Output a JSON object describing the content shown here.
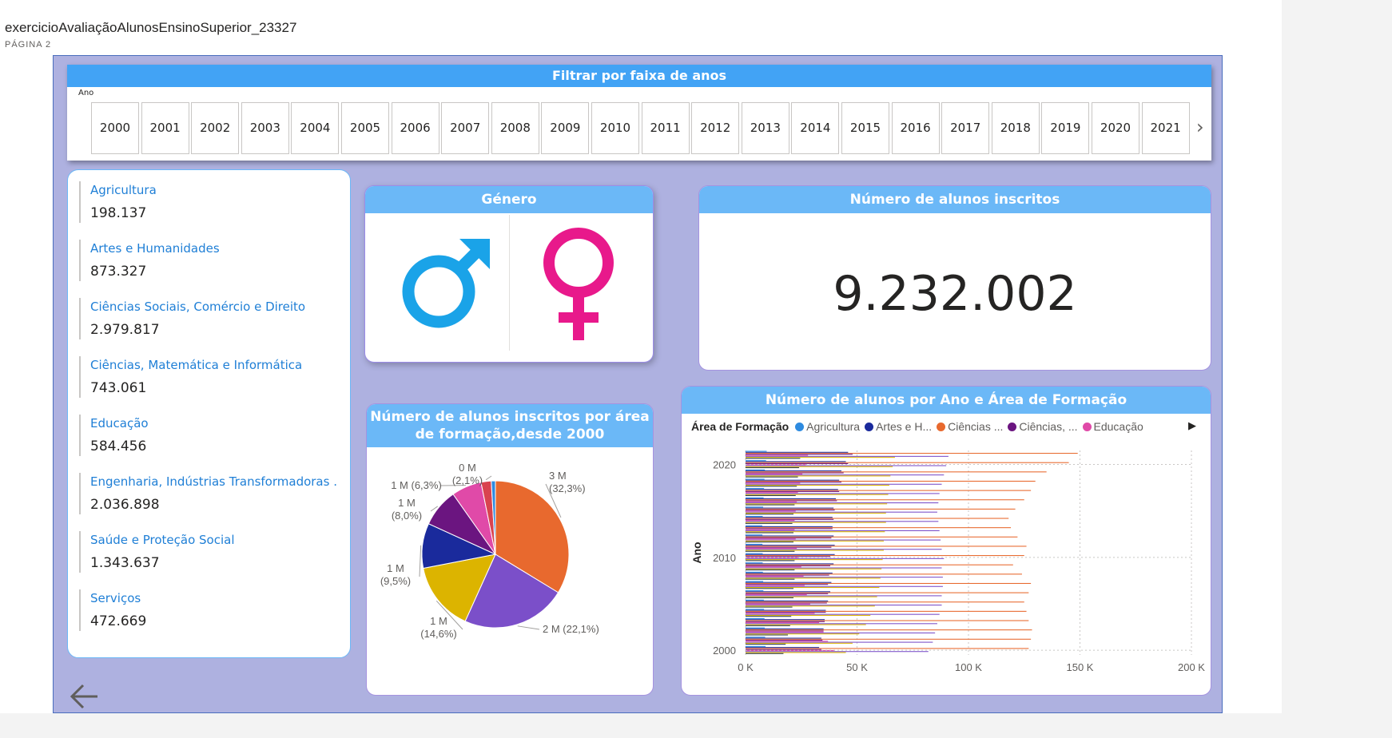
{
  "report": {
    "title": "exercicioAvaliaçãoAlunosEnsinoSuperior_23327",
    "page": "PÁGINA 2"
  },
  "slicer": {
    "title": "Filtrar por faixa de anos",
    "field_label": "Ano",
    "years": [
      "2000",
      "2001",
      "2002",
      "2003",
      "2004",
      "2005",
      "2006",
      "2007",
      "2008",
      "2009",
      "2010",
      "2011",
      "2012",
      "2013",
      "2014",
      "2015",
      "2016",
      "2017",
      "2018",
      "2019",
      "2020",
      "2021"
    ],
    "next_icon": "chevron-right-icon"
  },
  "areas": [
    {
      "label": "Agricultura",
      "value": "198.137"
    },
    {
      "label": "Artes e Humanidades",
      "value": "873.327"
    },
    {
      "label": "Ciências Sociais, Comércio e Direito",
      "value": "2.979.817"
    },
    {
      "label": "Ciências, Matemática e Informática",
      "value": "743.061"
    },
    {
      "label": "Educação",
      "value": "584.456"
    },
    {
      "label": "Engenharia, Indústrias Transformadoras ...",
      "value": "2.036.898"
    },
    {
      "label": "Saúde e Proteção Social",
      "value": "1.343.637"
    },
    {
      "label": "Serviços",
      "value": "472.669"
    }
  ],
  "gender": {
    "title": "Género",
    "icons": [
      "male-symbol-icon",
      "female-symbol-icon"
    ],
    "colors": {
      "male": "#1aa3e8",
      "female": "#e8198b"
    }
  },
  "total": {
    "title": "Número de alunos inscritos",
    "value": "9.232.002"
  },
  "pie": {
    "title_line1": "Número de alunos inscritos por área",
    "title_line2": "de formação,desde 2000"
  },
  "bar": {
    "title": "Número de alunos por Ano e Área de Formação",
    "legend_title": "Área de Formação",
    "legend": [
      {
        "name": "Agricultura",
        "color": "#2e8be0"
      },
      {
        "name": "Artes e H...",
        "color": "#1a2a9c"
      },
      {
        "name": "Ciências ...",
        "color": "#e8692e"
      },
      {
        "name": "Ciências, ...",
        "color": "#6b1580"
      },
      {
        "name": "Educação",
        "color": "#e04aa8"
      }
    ]
  },
  "chart_data": [
    {
      "type": "pie",
      "title": "Número de alunos inscritos por área de formação,desde 2000",
      "slices": [
        {
          "label": "3 M",
          "pct": "(32,3%)",
          "value": 2979817,
          "color": "#e8692e"
        },
        {
          "label": "2 M (22,1%)",
          "pct": "",
          "value": 2036898,
          "color": "#7b4fc9"
        },
        {
          "label": "1 M",
          "pct": "(14,6%)",
          "value": 1343637,
          "color": "#dcb400"
        },
        {
          "label": "1 M",
          "pct": "(9,5%)",
          "value": 873327,
          "color": "#1a2a9c"
        },
        {
          "label": "1 M",
          "pct": "(8,0%)",
          "value": 743061,
          "color": "#6b1580"
        },
        {
          "label": "1 M (6,3%)",
          "pct": "",
          "value": 584456,
          "color": "#e04aa8"
        },
        {
          "label": "0 M",
          "pct": "(2,1%)",
          "value": 198137,
          "color": "#d9434f"
        },
        {
          "label": "",
          "pct": "",
          "value": 80000,
          "color": "#2e8be0"
        }
      ]
    },
    {
      "type": "bar",
      "title": "Número de alunos por Ano e Área de Formação",
      "xlabel": "",
      "ylabel": "Ano",
      "xlim": [
        0,
        200000
      ],
      "xticks": [
        "0 K",
        "50 K",
        "100 K",
        "150 K",
        "200 K"
      ],
      "yticks": [
        "2000",
        "2010",
        "2020"
      ],
      "years": [
        2000,
        2001,
        2002,
        2003,
        2004,
        2005,
        2006,
        2007,
        2008,
        2009,
        2010,
        2011,
        2012,
        2013,
        2014,
        2015,
        2016,
        2017,
        2018,
        2019,
        2020,
        2021
      ],
      "series": [
        {
          "name": "Agricultura",
          "color": "#2e8be0",
          "values": [
            9000,
            8800,
            8600,
            8500,
            8300,
            8200,
            8000,
            7900,
            7800,
            7700,
            7700,
            7600,
            7600,
            7500,
            7700,
            7900,
            8100,
            8300,
            8500,
            8700,
            9200,
            9500
          ]
        },
        {
          "name": "Artes e H...",
          "color": "#1a2a9c",
          "values": [
            33000,
            34000,
            35000,
            35500,
            36000,
            37000,
            38000,
            38500,
            39000,
            39500,
            40000,
            40000,
            39500,
            39000,
            39000,
            39500,
            40500,
            41500,
            42000,
            43000,
            45000,
            46000
          ]
        },
        {
          "name": "Ciências ...",
          "color": "#e8692e",
          "values": [
            127000,
            128000,
            128500,
            127000,
            126000,
            125000,
            127000,
            128000,
            124000,
            120000,
            125000,
            126000,
            122000,
            119000,
            118000,
            121000,
            125000,
            128000,
            130000,
            135000,
            145000,
            149000
          ]
        },
        {
          "name": "Ciências, ...",
          "color": "#6b1580",
          "values": [
            34000,
            34500,
            35000,
            35500,
            36000,
            36500,
            37000,
            37000,
            37500,
            38000,
            38000,
            38500,
            38500,
            39000,
            39500,
            40000,
            41000,
            42000,
            43000,
            44000,
            46000,
            48000
          ]
        },
        {
          "name": "Educação",
          "color": "#e04aa8",
          "values": [
            40000,
            37000,
            35000,
            33000,
            31000,
            29000,
            27500,
            26500,
            26000,
            25000,
            24000,
            23000,
            22500,
            22000,
            22000,
            22500,
            23000,
            23500,
            24500,
            25500,
            27000,
            28000
          ]
        },
        {
          "name": "Engenharia",
          "color": "#7b4fc9",
          "values": [
            82000,
            84000,
            85000,
            86000,
            87000,
            88000,
            88000,
            88500,
            88500,
            88000,
            89000,
            88000,
            87500,
            87000,
            86500,
            86000,
            86500,
            87000,
            88000,
            89000,
            90000,
            91000
          ]
        },
        {
          "name": "Saúde",
          "color": "#dcb400",
          "values": [
            45000,
            48000,
            51000,
            54000,
            56000,
            58000,
            59000,
            60000,
            60500,
            61000,
            61500,
            62000,
            62000,
            62500,
            63000,
            63000,
            63500,
            64000,
            64500,
            65000,
            66000,
            67000
          ]
        },
        {
          "name": "Serviços",
          "color": "#2b3a4a",
          "values": [
            17000,
            18000,
            19000,
            20000,
            20500,
            21000,
            21500,
            21500,
            22000,
            22000,
            22000,
            22000,
            21500,
            21500,
            21000,
            21500,
            22000,
            22500,
            23000,
            23500,
            24000,
            24500
          ]
        }
      ]
    }
  ]
}
